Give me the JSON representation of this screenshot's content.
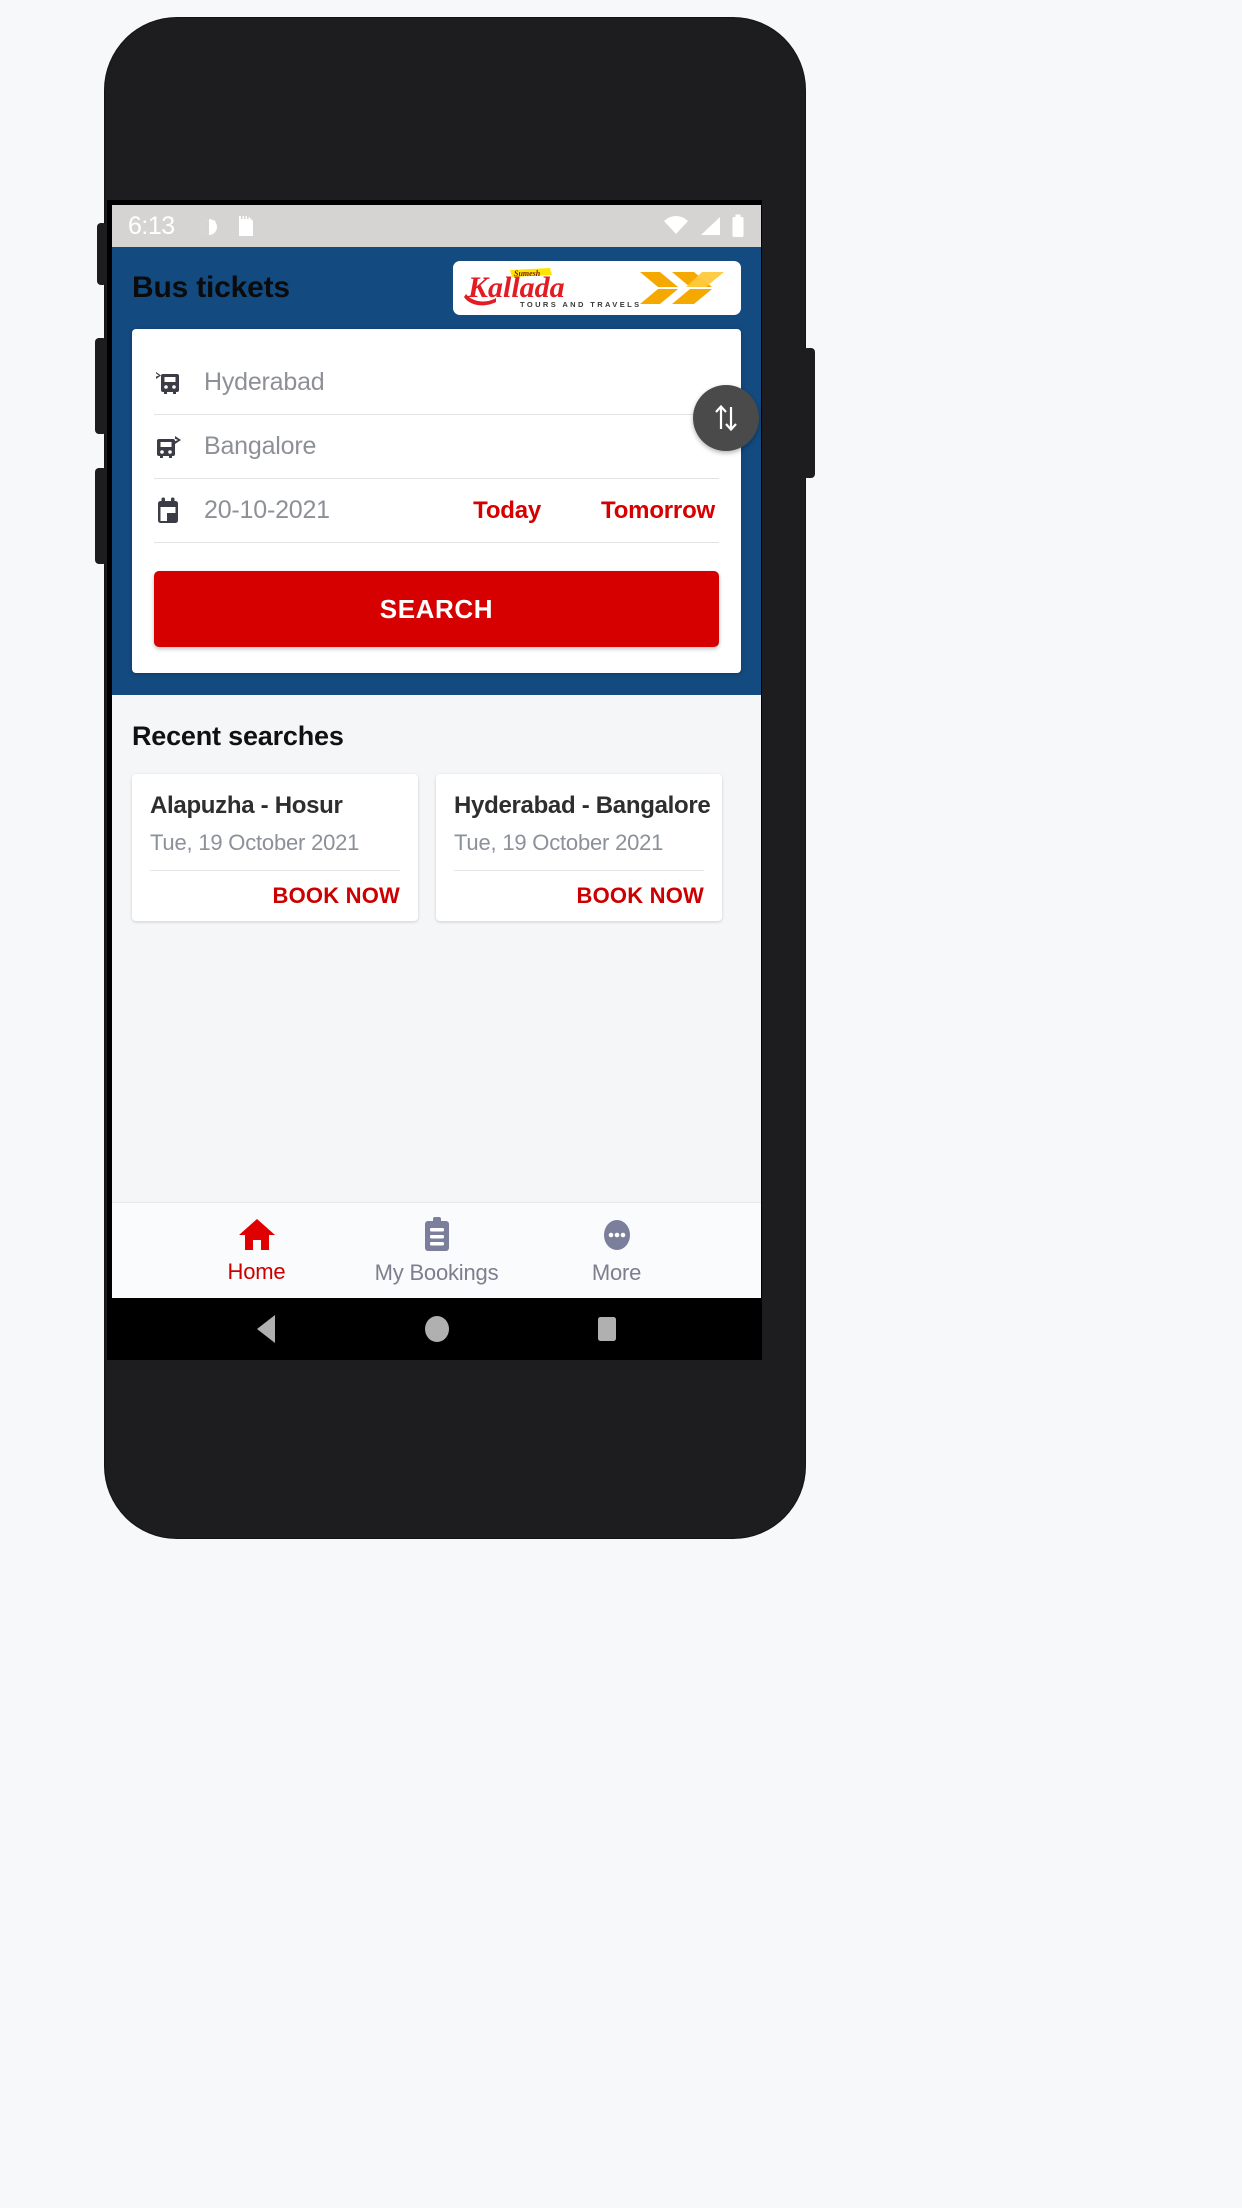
{
  "status_bar": {
    "time": "6:13",
    "left_icons": [
      "alarm-icon",
      "sd-card-icon"
    ],
    "right_icons": [
      "wifi-icon",
      "signal-icon",
      "battery-icon"
    ]
  },
  "app_bar": {
    "title": "Bus tickets",
    "logo": {
      "brand": "Kallada",
      "tagline": "TOURS AND TRAVELS",
      "superscript": "Sumesh",
      "brand_color": "#e31b23",
      "chevron_color": "#f5a800",
      "highlight_color": "#ffe400"
    }
  },
  "search_form": {
    "source": {
      "value": "Hyderabad",
      "icon": "bus-departure-icon"
    },
    "destination": {
      "value": "Bangalore",
      "icon": "bus-arrival-icon"
    },
    "date": {
      "value": "20-10-2021",
      "icon": "calendar-icon"
    },
    "quick_dates": [
      {
        "label": "Today"
      },
      {
        "label": "Tomorrow"
      }
    ],
    "swap_button_icon": "swap-vertical-icon",
    "search_button_label": "SEARCH"
  },
  "recent": {
    "title": "Recent searches",
    "cards": [
      {
        "route": "Alapuzha - Hosur",
        "date": "Tue, 19 October 2021",
        "action": "BOOK NOW"
      },
      {
        "route": "Hyderabad - Bangalore",
        "date": "Tue, 19 October 2021",
        "action": "BOOK NOW"
      }
    ]
  },
  "bottom_nav": {
    "items": [
      {
        "label": "Home",
        "icon": "home-icon",
        "active": true
      },
      {
        "label": "My Bookings",
        "icon": "clipboard-icon",
        "active": false
      },
      {
        "label": "More",
        "icon": "more-dots-icon",
        "active": false
      }
    ]
  },
  "android_nav": {
    "back": "back-triangle-icon",
    "home": "home-circle-icon",
    "recents": "recents-square-icon"
  },
  "colors": {
    "app_bar_blue": "#134a80",
    "accent_red": "#d60000",
    "page_background": "#f5f6f8",
    "status_bar": "#d6d4d2"
  }
}
